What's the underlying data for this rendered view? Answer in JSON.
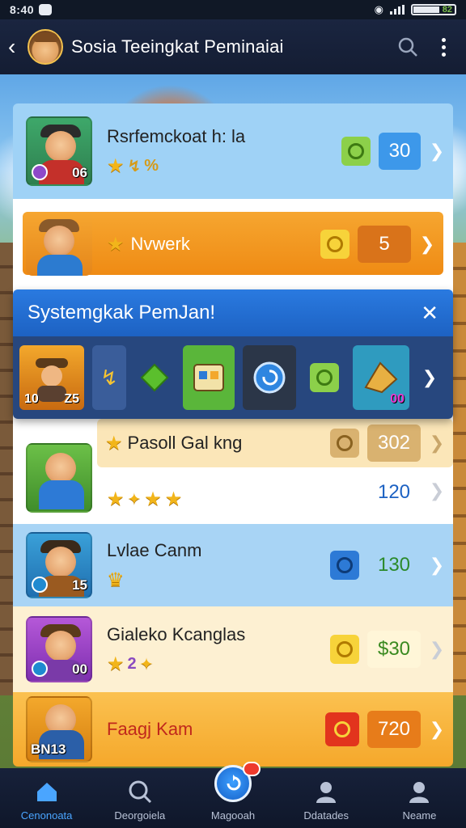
{
  "status_bar": {
    "time": "8:40",
    "battery": "82"
  },
  "header": {
    "title": "Sosia Teeingkat Peminaiai"
  },
  "rows": [
    {
      "name": "Rsrfemckoat h: la",
      "level": "06",
      "value": "30",
      "extra": "%"
    },
    {
      "name": "Nvwerk",
      "value": "5"
    },
    {
      "name": "Pasoll Gal kng",
      "value": "302"
    },
    {
      "name": "",
      "value": "120"
    },
    {
      "name": "Lvlae Canm",
      "level": "15",
      "value": "130"
    },
    {
      "name": "Gialeko Kcanglas",
      "level": "00",
      "value": "$30",
      "star_count": "2"
    },
    {
      "name": "Faagj Kam",
      "level": "BN13",
      "value": "720"
    }
  ],
  "popup": {
    "title": "Systemgkak PemJan!",
    "tile_labels": [
      "10",
      "Z5",
      "00"
    ]
  },
  "bottom_nav": [
    {
      "label": "Cenonoata"
    },
    {
      "label": "Deorgoiela"
    },
    {
      "label": "Magooah"
    },
    {
      "label": "Ddatades"
    },
    {
      "label": "Neame"
    }
  ],
  "colors": {
    "accent_blue": "#4aa5ff",
    "popup_blue": "#1d62c3",
    "row_orange": "#f39a1f",
    "gold": "#f2b51a"
  }
}
